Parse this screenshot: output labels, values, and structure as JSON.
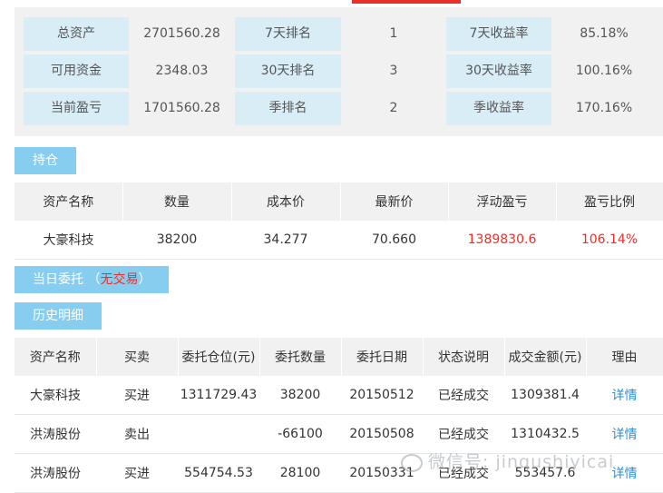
{
  "summary": {
    "rows": [
      {
        "l1": "总资产",
        "v1": "2701560.28",
        "l2": "7天排名",
        "v2": "1",
        "l3": "7天收益率",
        "v3": "85.18%"
      },
      {
        "l1": "可用资金",
        "v1": "2348.03",
        "l2": "30天排名",
        "v2": "3",
        "l3": "30天收益率",
        "v3": "100.16%"
      },
      {
        "l1": "当前盈亏",
        "v1": "1701560.28",
        "l2": "季排名",
        "v2": "2",
        "l3": "季收益率",
        "v3": "170.16%"
      }
    ]
  },
  "sections": {
    "holdings": "持仓",
    "today_orders": "当日委托",
    "today_paren_open": "（",
    "today_status": "无交易",
    "today_paren_close": "）",
    "history": "历史明细"
  },
  "holdings": {
    "headers": [
      "资产名称",
      "数量",
      "成本价",
      "最新价",
      "浮动盈亏",
      "盈亏比例"
    ],
    "rows": [
      {
        "name": "大豪科技",
        "qty": "38200",
        "cost": "34.277",
        "price": "70.660",
        "pnl": "1389830.6",
        "ratio": "106.14%"
      }
    ]
  },
  "history": {
    "headers": [
      "资产名称",
      "买卖",
      "委托仓位(元)",
      "委托数量",
      "委托日期",
      "状态说明",
      "成交金额(元)",
      "理由"
    ],
    "rows": [
      {
        "name": "大豪科技",
        "side": "买进",
        "position": "1311729.43",
        "qty": "38200",
        "date": "20150512",
        "status": "已经成交",
        "amount": "1309381.4",
        "reason": "详情"
      },
      {
        "name": "洪涛股份",
        "side": "卖出",
        "position": "",
        "qty": "-66100",
        "date": "20150508",
        "status": "已经成交",
        "amount": "1310432.5",
        "reason": "详情"
      },
      {
        "name": "洪涛股份",
        "side": "买进",
        "position": "554754.53",
        "qty": "28100",
        "date": "20150331",
        "status": "已经成交",
        "amount": "553457.6",
        "reason": "详情"
      }
    ]
  },
  "watermark": "微信号: jinqushiyicai",
  "colors": {
    "accent": "#86cdf0",
    "label_bg": "#d9edf7",
    "negative": "#e8302a",
    "link": "#2a8fd6"
  }
}
